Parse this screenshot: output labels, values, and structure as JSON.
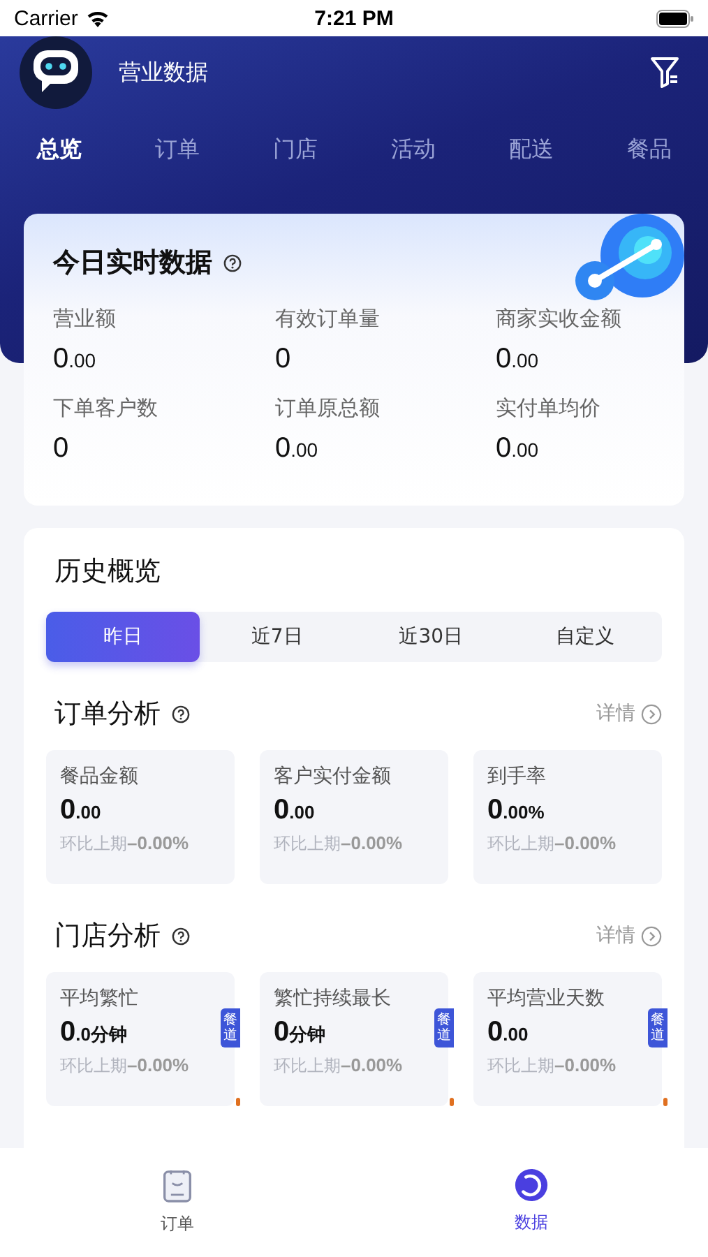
{
  "status_bar": {
    "carrier": "Carrier",
    "time": "7:21 PM"
  },
  "header": {
    "title": "营业数据"
  },
  "tabs": [
    {
      "label": "总览",
      "selected": true
    },
    {
      "label": "订单",
      "selected": false
    },
    {
      "label": "门店",
      "selected": false
    },
    {
      "label": "活动",
      "selected": false
    },
    {
      "label": "配送",
      "selected": false
    },
    {
      "label": "餐品",
      "selected": false
    }
  ],
  "realtime": {
    "title": "今日实时数据",
    "items": [
      {
        "label": "营业额",
        "value": "0",
        "decimals": ".00"
      },
      {
        "label": "有效订单量",
        "value": "0"
      },
      {
        "label": "商家实收金额",
        "value": "0",
        "decimals": ".00"
      },
      {
        "label": "下单客户数",
        "value": "0"
      },
      {
        "label": "订单原总额",
        "value": "0",
        "decimals": ".00"
      },
      {
        "label": "实付单均价",
        "value": "0",
        "decimals": ".00"
      }
    ]
  },
  "history": {
    "title": "历史概览",
    "periods": [
      {
        "label": "昨日",
        "selected": true
      },
      {
        "label": "近7日",
        "selected": false
      },
      {
        "label": "近30日",
        "selected": false
      },
      {
        "label": "自定义",
        "selected": false
      }
    ],
    "sections": [
      {
        "title": "订单分析",
        "detail": "详情",
        "cards": [
          {
            "label": "餐品金额",
            "value": "0",
            "decimals": ".00",
            "change_label": "环比上期",
            "change": "–0.00%"
          },
          {
            "label": "客户实付金额",
            "value": "0",
            "decimals": ".00",
            "change_label": "环比上期",
            "change": "–0.00%"
          },
          {
            "label": "到手率",
            "value": "0",
            "decimals": ".00%",
            "change_label": "环比上期",
            "change": "–0.00%"
          }
        ]
      },
      {
        "title": "门店分析",
        "detail": "详情",
        "cards": [
          {
            "label": "平均繁忙",
            "value": "0",
            "decimals": ".0分钟",
            "change_label": "环比上期",
            "change": "–0.00%",
            "tag": "餐道"
          },
          {
            "label": "繁忙持续最长",
            "value": "0",
            "decimals": "分钟",
            "change_label": "环比上期",
            "change": "–0.00%",
            "tag": "餐道"
          },
          {
            "label": "平均营业天数",
            "value": "0",
            "decimals": ".00",
            "change_label": "环比上期",
            "change": "–0.00%",
            "tag": "餐道"
          }
        ]
      }
    ]
  },
  "bottom_nav": [
    {
      "label": "订单",
      "kind": "orders",
      "selected": false
    },
    {
      "label": "数据",
      "kind": "data",
      "selected": true
    }
  ]
}
